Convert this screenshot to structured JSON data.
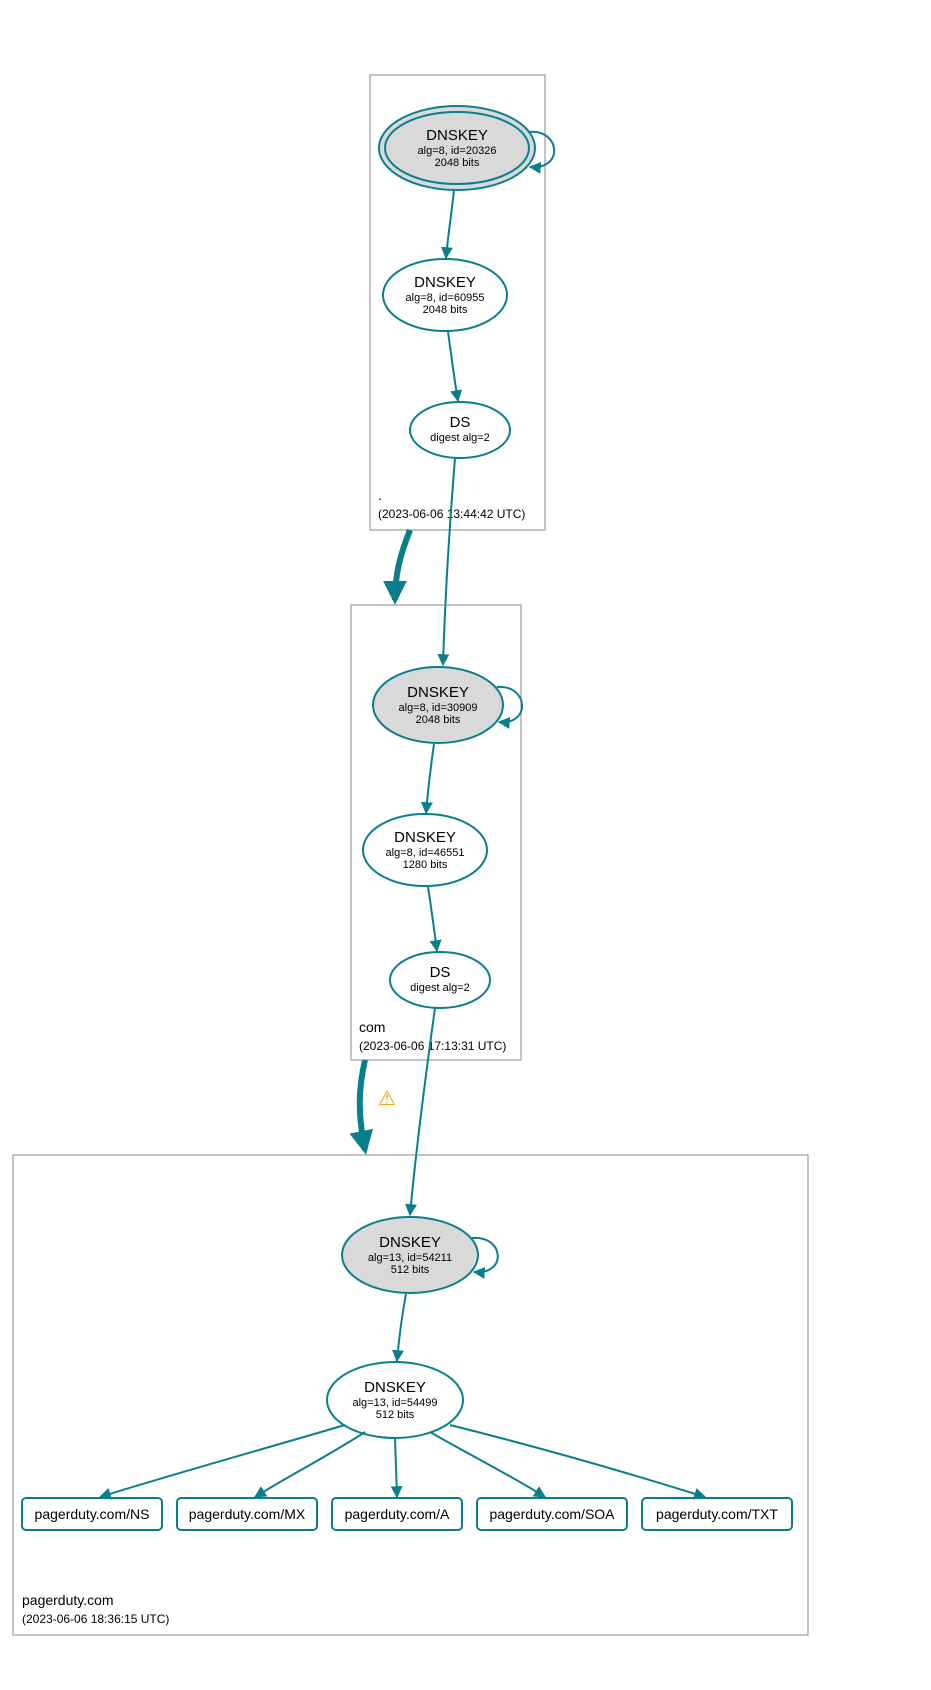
{
  "zones": {
    "root": {
      "label": ".",
      "timestamp": "(2023-06-06 13:44:42 UTC)",
      "nodes": {
        "ksk": {
          "title": "DNSKEY",
          "line2": "alg=8, id=20326",
          "line3": "2048 bits"
        },
        "zsk": {
          "title": "DNSKEY",
          "line2": "alg=8, id=60955",
          "line3": "2048 bits"
        },
        "ds": {
          "title": "DS",
          "line2": "digest alg=2",
          "line3": ""
        }
      }
    },
    "com": {
      "label": "com",
      "timestamp": "(2023-06-06 17:13:31 UTC)",
      "nodes": {
        "ksk": {
          "title": "DNSKEY",
          "line2": "alg=8, id=30909",
          "line3": "2048 bits"
        },
        "zsk": {
          "title": "DNSKEY",
          "line2": "alg=8, id=46551",
          "line3": "1280 bits"
        },
        "ds": {
          "title": "DS",
          "line2": "digest alg=2",
          "line3": ""
        }
      }
    },
    "pagerduty": {
      "label": "pagerduty.com",
      "timestamp": "(2023-06-06 18:36:15 UTC)",
      "nodes": {
        "ksk": {
          "title": "DNSKEY",
          "line2": "alg=13, id=54211",
          "line3": "512 bits"
        },
        "zsk": {
          "title": "DNSKEY",
          "line2": "alg=13, id=54499",
          "line3": "512 bits"
        }
      },
      "records": {
        "ns": "pagerduty.com/NS",
        "mx": "pagerduty.com/MX",
        "a": "pagerduty.com/A",
        "soa": "pagerduty.com/SOA",
        "txt": "pagerduty.com/TXT"
      }
    }
  },
  "warning_icon": "⚠"
}
